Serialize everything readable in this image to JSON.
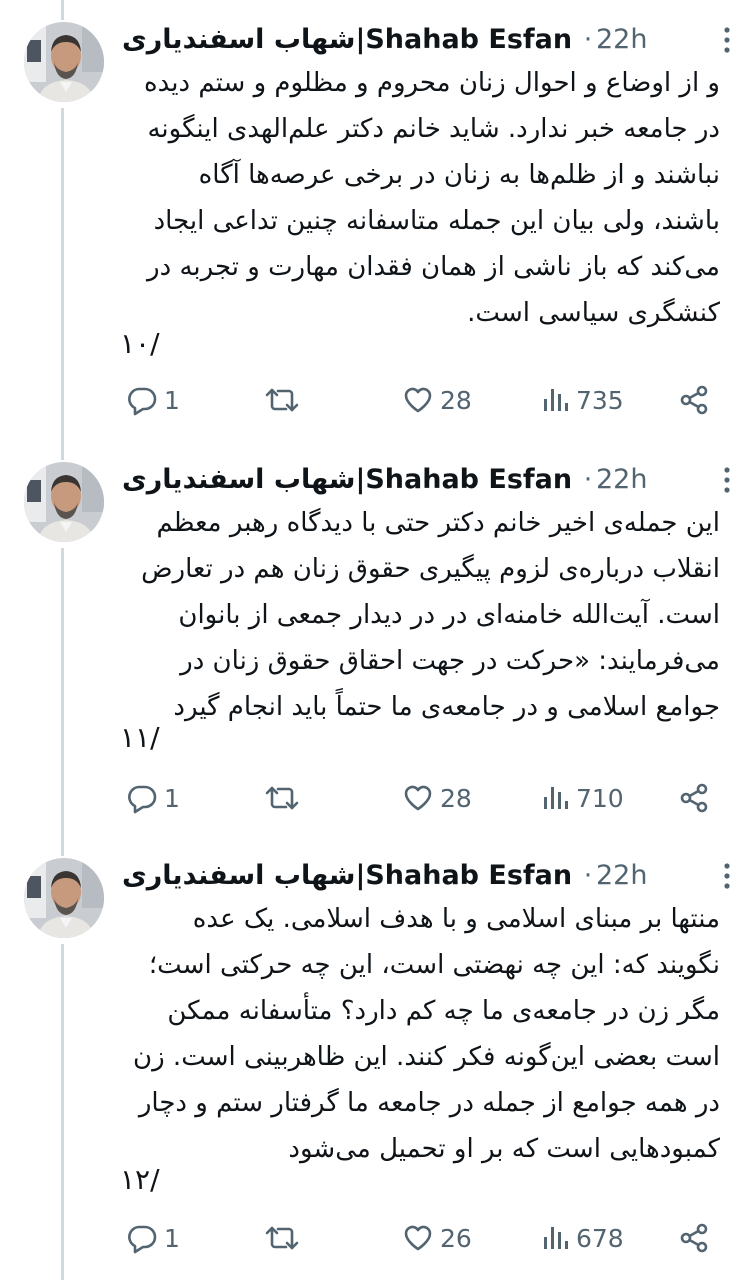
{
  "colors": {
    "secondary_text": "#536471",
    "thread_line": "#cfd9de",
    "text": "#0f1419"
  },
  "icons": [
    "more-vertical-icon",
    "reply-icon",
    "retweet-icon",
    "like-icon",
    "views-icon",
    "share-icon"
  ],
  "tweets": [
    {
      "display_name": "شهاب اسفندیاری|Shahab Esfan...",
      "dot": "·",
      "time": "22h",
      "lines": [
        "و از اوضاع و احوال زنان محروم و مظلوم و ستم دیده",
        "در جامعه خبر ندارد. شاید خانم دکتر علم‌الهدی اینگونه",
        "نباشند و از ظلم‌ها به زنان در برخی عرصه‌ها آگاه",
        "باشند، ولی بیان این جمله متاسفانه چنین تداعی ایجاد",
        "می‌کند که باز ناشی از همان فقدان مهارت و تجربه در",
        "کنشگری سیاسی است."
      ],
      "thread_number": "۱۰/",
      "replies": "1",
      "likes": "28",
      "views": "735"
    },
    {
      "display_name": "شهاب اسفندیاری|Shahab Esfan...",
      "dot": "·",
      "time": "22h",
      "lines": [
        "این جمله‌ی اخیر خانم دکتر حتی با دیدگاه رهبر معظم",
        "انقلاب درباره‌ی لزوم پیگیری حقوق زنان هم در تعارض",
        "است. آیت‌الله خامنه‌ای در  در دیدار جمعی از بانوان",
        "می‌فرمایند: «حرکت در جهت احقاق حقوق زنان در",
        "جوامع اسلامی و در جامعه‌ی ما حتماً باید انجام گیرد"
      ],
      "thread_number": "۱۱/",
      "replies": "1",
      "likes": "28",
      "views": "710"
    },
    {
      "display_name": "شهاب اسفندیاری|Shahab Esfan...",
      "dot": "·",
      "time": "22h",
      "lines": [
        "منتها بر مبنای اسلامی و با هدف اسلامی. یک عده",
        "نگویند که: این چه نهضتی است، این چه حرکتی است؛",
        "مگر زن در جامعه‌ی ما چه کم دارد؟ متأسفانه ممکن",
        "است بعضی این‌گونه فکر کنند. این ظاهربینی است. زن",
        "در همه جوامع از جمله در جامعه ما گرفتار ستم و دچار",
        "کمبودهایی است که بر او تحمیل می‌شود"
      ],
      "thread_number": "۱۲/",
      "replies": "1",
      "likes": "26",
      "views": "678"
    }
  ]
}
